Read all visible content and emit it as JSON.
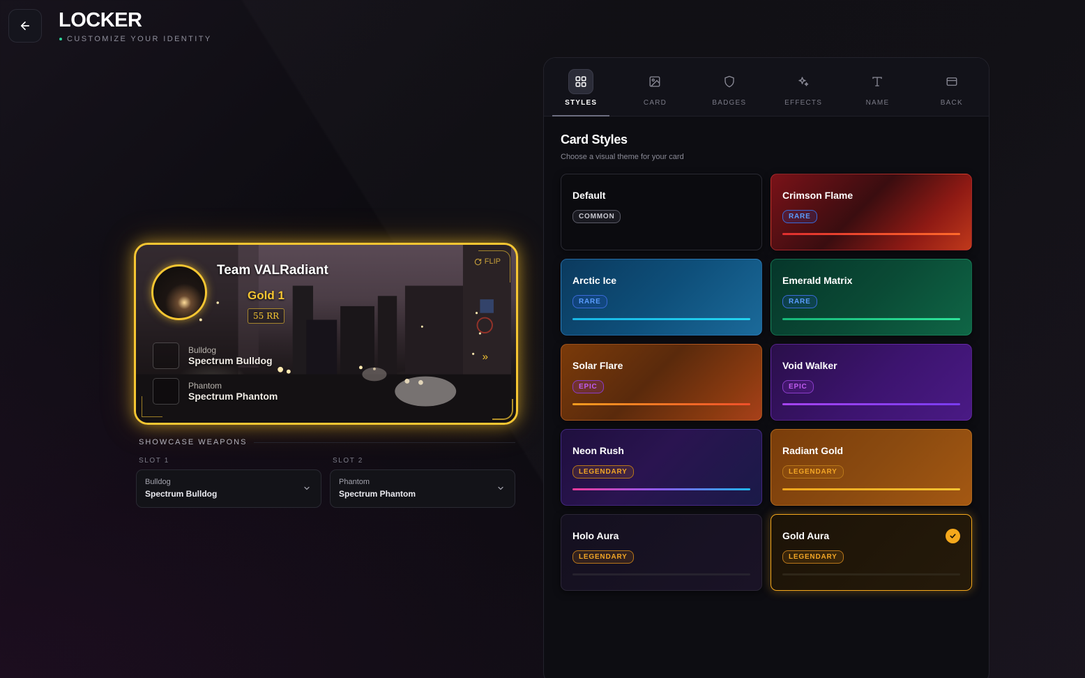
{
  "header": {
    "title": "LOCKER",
    "subtitle": "CUSTOMIZE YOUR IDENTITY"
  },
  "player_card": {
    "name": "Team VALRadiant",
    "rank": "Gold 1",
    "rr": "55 RR",
    "flip_label": "FLIP",
    "weapons": [
      {
        "type": "Bulldog",
        "name": "Spectrum Bulldog"
      },
      {
        "type": "Phantom",
        "name": "Spectrum Phantom"
      }
    ]
  },
  "showcase": {
    "heading": "SHOWCASE WEAPONS",
    "slots": [
      {
        "label": "SLOT 1",
        "type": "Bulldog",
        "name": "Spectrum Bulldog"
      },
      {
        "label": "SLOT 2",
        "type": "Phantom",
        "name": "Spectrum Phantom"
      }
    ]
  },
  "tabs": [
    {
      "label": "STYLES",
      "icon": "grid-icon",
      "active": true
    },
    {
      "label": "CARD",
      "icon": "image-icon",
      "active": false
    },
    {
      "label": "BADGES",
      "icon": "shield-icon",
      "active": false
    },
    {
      "label": "EFFECTS",
      "icon": "sparkles-icon",
      "active": false
    },
    {
      "label": "NAME",
      "icon": "type-icon",
      "active": false
    },
    {
      "label": "BACK",
      "icon": "card-back-icon",
      "active": false
    }
  ],
  "card_styles": {
    "title": "Card Styles",
    "subtitle": "Choose a visual theme for your card",
    "items": [
      {
        "name": "Default",
        "rarity": "COMMON",
        "selected": false
      },
      {
        "name": "Crimson Flame",
        "rarity": "RARE",
        "selected": false
      },
      {
        "name": "Arctic Ice",
        "rarity": "RARE",
        "selected": false
      },
      {
        "name": "Emerald Matrix",
        "rarity": "RARE",
        "selected": false
      },
      {
        "name": "Solar Flare",
        "rarity": "EPIC",
        "selected": false
      },
      {
        "name": "Void Walker",
        "rarity": "EPIC",
        "selected": false
      },
      {
        "name": "Neon Rush",
        "rarity": "LEGENDARY",
        "selected": false
      },
      {
        "name": "Radiant Gold",
        "rarity": "LEGENDARY",
        "selected": false
      },
      {
        "name": "Holo Aura",
        "rarity": "LEGENDARY",
        "selected": false
      },
      {
        "name": "Gold Aura",
        "rarity": "LEGENDARY",
        "selected": true
      }
    ]
  },
  "colors": {
    "gold": "#f6c632",
    "selected_accent": "#f5a81c",
    "status_dot": "#2fd39a"
  }
}
